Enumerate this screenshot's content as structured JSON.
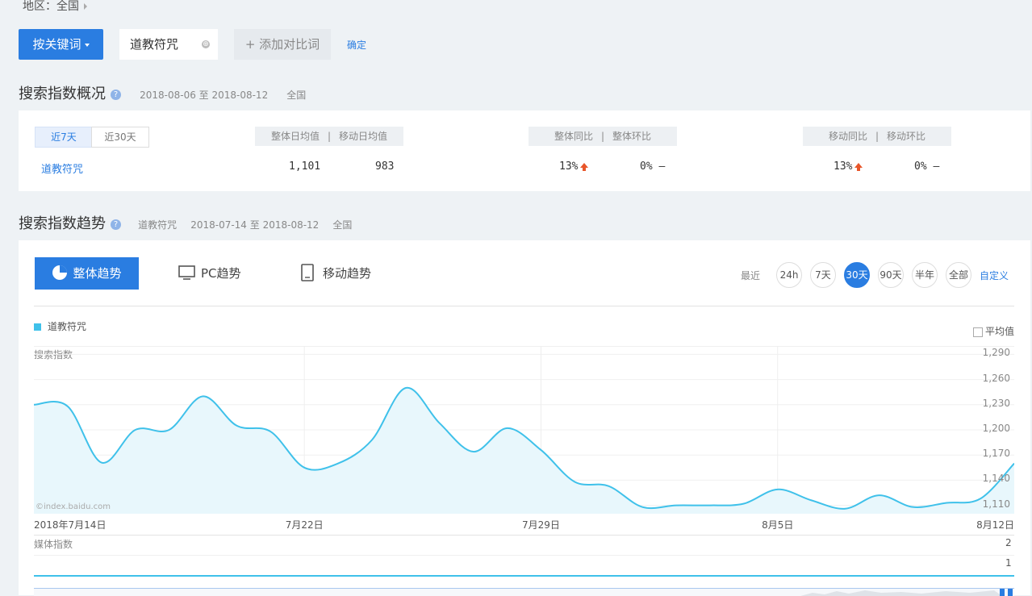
{
  "region": {
    "label": "地区：",
    "value": "全国"
  },
  "toolbar": {
    "keyword_button": "按关键词",
    "keyword": "道教符咒",
    "add_compare": "+ 添加对比词",
    "confirm": "确定"
  },
  "overview": {
    "title": "搜索指数概况",
    "date_range": "2018-08-06 至 2018-08-12",
    "region": "全国",
    "tabs": [
      "近7天",
      "近30天"
    ],
    "headers": {
      "avg": "整体日均值",
      "mobile_avg": "移动日均值",
      "yoy": "整体同比",
      "mom": "整体环比",
      "m_yoy": "移动同比",
      "m_mom": "移动环比"
    },
    "separator": "|",
    "row": {
      "keyword": "道教符咒",
      "avg": "1,101",
      "mobile_avg": "983",
      "yoy": "13%",
      "mom": "0%",
      "m_yoy": "13%",
      "m_mom": "0%",
      "flat": "—"
    }
  },
  "trend": {
    "title": "搜索指数趋势",
    "keyword": "道教符咒",
    "date_range": "2018-07-14 至 2018-08-12",
    "region": "全国",
    "tabs": [
      "整体趋势",
      "PC趋势",
      "移动趋势"
    ],
    "recent_label": "最近",
    "ranges": [
      "24h",
      "7天",
      "30天",
      "90天",
      "半年",
      "全部"
    ],
    "active_range": "30天",
    "custom": "自定义",
    "avg_checkbox": "平均值",
    "watermark": "©index.baidu.com",
    "media_label": "媒体指数",
    "media_ticks": [
      "2",
      "1"
    ]
  },
  "colors": {
    "accent": "#2a7de1",
    "series": "#3fc1ea",
    "fill": "#e8f7fc"
  },
  "chart_data": {
    "type": "area",
    "ylabel": "搜索指数",
    "ylim": [
      1100,
      1300
    ],
    "yticks": [
      "1,110",
      "1,140",
      "1,170",
      "1,200",
      "1,230",
      "1,260",
      "1,290"
    ],
    "ytick_values": [
      1110,
      1140,
      1170,
      1200,
      1230,
      1260,
      1290
    ],
    "xticks": [
      {
        "label": "2018年7月14日",
        "index": 0
      },
      {
        "label": "7月22日",
        "index": 8
      },
      {
        "label": "7月29日",
        "index": 15
      },
      {
        "label": "8月5日",
        "index": 22
      },
      {
        "label": "8月12日",
        "index": 29
      }
    ],
    "x": [
      "2018-07-14",
      "2018-07-15",
      "2018-07-16",
      "2018-07-17",
      "2018-07-18",
      "2018-07-19",
      "2018-07-20",
      "2018-07-21",
      "2018-07-22",
      "2018-07-23",
      "2018-07-24",
      "2018-07-25",
      "2018-07-26",
      "2018-07-27",
      "2018-07-28",
      "2018-07-29",
      "2018-07-30",
      "2018-07-31",
      "2018-08-01",
      "2018-08-02",
      "2018-08-03",
      "2018-08-04",
      "2018-08-05",
      "2018-08-06",
      "2018-08-07",
      "2018-08-08",
      "2018-08-09",
      "2018-08-10",
      "2018-08-11",
      "2018-08-12"
    ],
    "series": [
      {
        "name": "道教符咒",
        "values": [
          1230,
          1228,
          1161,
          1200,
          1200,
          1240,
          1205,
          1198,
          1155,
          1160,
          1188,
          1250,
          1208,
          1174,
          1202,
          1176,
          1138,
          1133,
          1108,
          1110,
          1110,
          1112,
          1129,
          1116,
          1106,
          1122,
          1108,
          1113,
          1118,
          1160
        ]
      }
    ]
  }
}
